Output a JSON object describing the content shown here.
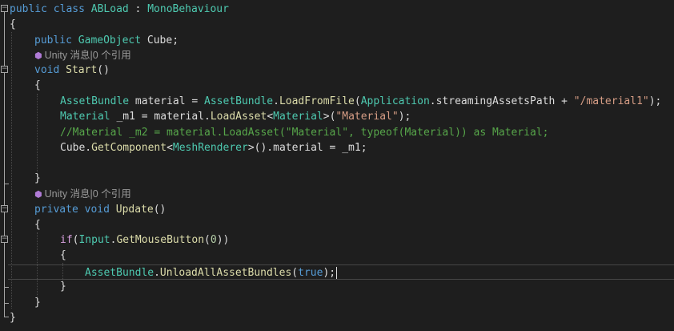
{
  "lines": [
    [
      [
        "kw",
        "public"
      ],
      [
        "pln",
        " "
      ],
      [
        "kw",
        "class"
      ],
      [
        "pln",
        " "
      ],
      [
        "typ",
        "ABLoad"
      ],
      [
        "pln",
        " : "
      ],
      [
        "typ",
        "MonoBehaviour"
      ]
    ],
    [
      [
        "pln",
        "{"
      ]
    ],
    [
      [
        "kw",
        "public"
      ],
      [
        "pln",
        " "
      ],
      [
        "typ",
        "GameObject"
      ],
      [
        "pln",
        " Cube;"
      ]
    ],
    [
      [
        "pln",
        "Unity 消息|0 个引用"
      ]
    ],
    [
      [
        "kw",
        "void"
      ],
      [
        "pln",
        " "
      ],
      [
        "mth",
        "Start"
      ],
      [
        "pln",
        "()"
      ]
    ],
    [
      [
        "pln",
        "{"
      ]
    ],
    [],
    [
      [
        "typ",
        "AssetBundle"
      ],
      [
        "pln",
        " material = "
      ],
      [
        "typ",
        "AssetBundle"
      ],
      [
        "pln",
        "."
      ],
      [
        "mth",
        "LoadFromFile"
      ],
      [
        "pln",
        "("
      ],
      [
        "typ",
        "Application"
      ],
      [
        "pln",
        ".streamingAssetsPath + "
      ],
      [
        "str",
        "\"/material1\""
      ],
      [
        "pln",
        ");"
      ]
    ],
    [
      [
        "typ",
        "Material"
      ],
      [
        "pln",
        " _m1 = material."
      ],
      [
        "mth",
        "LoadAsset"
      ],
      [
        "pln",
        "<"
      ],
      [
        "typ",
        "Material"
      ],
      [
        "pln",
        ">("
      ],
      [
        "str",
        "\"Material\""
      ],
      [
        "pln",
        ");"
      ]
    ],
    [
      [
        "cmt",
        "//Material _m2 = material.LoadAsset(\"Material\", typeof(Material)) as Material;"
      ]
    ],
    [
      [
        "pln",
        "Cube."
      ],
      [
        "mth",
        "GetComponent"
      ],
      [
        "pln",
        "<"
      ],
      [
        "typ",
        "MeshRenderer"
      ],
      [
        "pln",
        ">().material = _m1;"
      ]
    ],
    [],
    [
      [
        "pln",
        "}"
      ]
    ],
    [
      [
        "pln",
        "Unity 消息|0 个引用"
      ]
    ],
    [
      [
        "kw",
        "private"
      ],
      [
        "pln",
        " "
      ],
      [
        "kw",
        "void"
      ],
      [
        "pln",
        " "
      ],
      [
        "mth",
        "Update"
      ],
      [
        "pln",
        "()"
      ]
    ],
    [
      [
        "pln",
        "{"
      ]
    ],
    [
      [
        "ctl",
        "if"
      ],
      [
        "pln",
        "("
      ],
      [
        "typ",
        "Input"
      ],
      [
        "pln",
        "."
      ],
      [
        "mth",
        "GetMouseButton"
      ],
      [
        "pln",
        "("
      ],
      [
        "num",
        "0"
      ],
      [
        "pln",
        "))"
      ]
    ],
    [
      [
        "pln",
        "{"
      ]
    ],
    [
      [
        "typ",
        "AssetBundle"
      ],
      [
        "pln",
        "."
      ],
      [
        "mth",
        "UnloadAllAssetBundles"
      ],
      [
        "pln",
        "("
      ],
      [
        "kw",
        "true"
      ],
      [
        "pln",
        ");"
      ]
    ],
    [
      [
        "pln",
        "}"
      ]
    ],
    [
      [
        "pln",
        "}"
      ]
    ],
    [
      [
        "pln",
        "}"
      ]
    ]
  ]
}
